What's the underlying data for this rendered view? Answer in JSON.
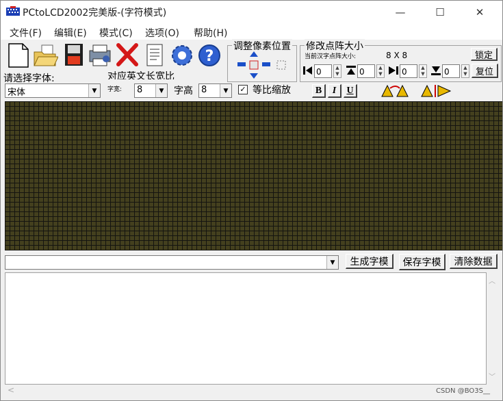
{
  "window": {
    "title": "PCtoLCD2002完美版-(字符模式)",
    "controls": {
      "minimize": "—",
      "maximize": "☐",
      "close": "✕"
    }
  },
  "menu": {
    "items": [
      {
        "label": "文件(F)"
      },
      {
        "label": "编辑(E)"
      },
      {
        "label": "模式(C)"
      },
      {
        "label": "选项(O)"
      },
      {
        "label": "帮助(H)"
      }
    ]
  },
  "toolbar": {
    "icons": [
      "new-file-icon",
      "open-folder-icon",
      "save-disk-icon",
      "print-icon",
      "delete-x-icon",
      "notepad-icon",
      "settings-gear-icon",
      "help-question-icon"
    ]
  },
  "pixel_pos": {
    "title": "调整像素位置"
  },
  "dot_size": {
    "title": "修改点阵大小",
    "current_label": "当前汉字点阵大小:",
    "current_value": "8 X 8",
    "lock_label": "锁定",
    "restore_label": "复位",
    "spins": [
      "0",
      "0",
      "0",
      "0"
    ]
  },
  "font": {
    "select_label": "请选择字体:",
    "font_value": "宋体",
    "ratio_label": "对应英文长宽比",
    "width_label": "字宽:",
    "width_value": "8",
    "height_label": "字高",
    "height_value": "8",
    "proportional_label": "等比缩放",
    "proportional_checked": "✓"
  },
  "style_buttons": {
    "bold": "B",
    "italic": "I",
    "underline": "U"
  },
  "actions": {
    "input_value": "",
    "generate_label": "生成字模",
    "save_label": "保存字模",
    "clear_label": "清除数据"
  },
  "watermark": "CSDN @BO3S__",
  "colors": {
    "grid_dot": "#44401e",
    "grid_bg": "#141410"
  }
}
